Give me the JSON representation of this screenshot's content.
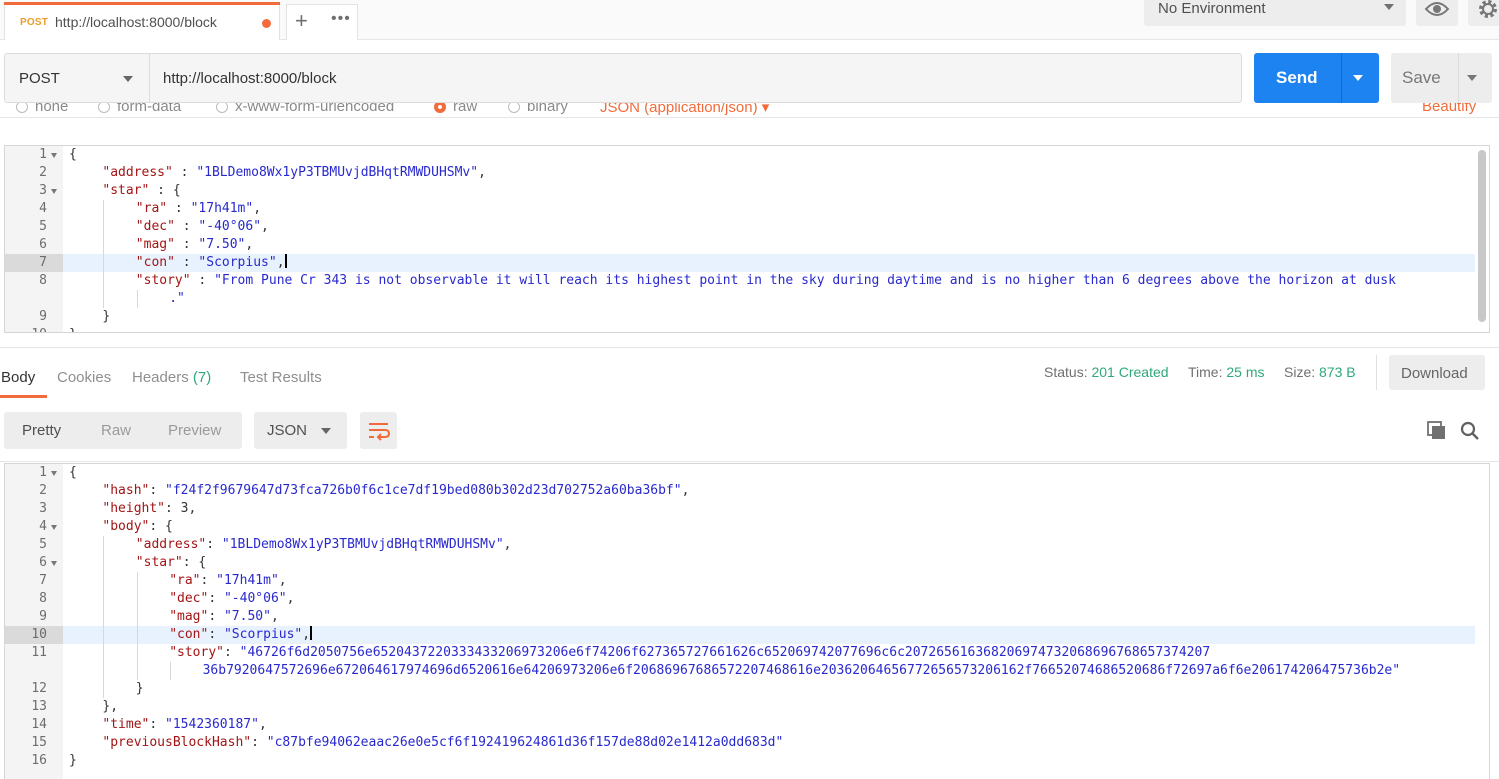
{
  "tab": {
    "method": "POST",
    "title": "http://localhost:8000/block"
  },
  "tab_actions": {
    "plus": "+",
    "more": "•••"
  },
  "environment": {
    "selected": "No Environment"
  },
  "request": {
    "method": "POST",
    "url": "http://localhost:8000/block",
    "send_label": "Send",
    "save_label": "Save"
  },
  "body_types": [
    "none",
    "form-data",
    "x-www-form-urlencoded",
    "raw",
    "binary",
    "JSON (application/json)",
    "Beautify"
  ],
  "request_body_lines": [
    {
      "n": "1",
      "fold": true,
      "indent": 0,
      "parts": [
        [
          "p",
          "{"
        ]
      ]
    },
    {
      "n": "2",
      "fold": false,
      "indent": 1,
      "parts": [
        [
          "k",
          "\"address\""
        ],
        [
          "p",
          " : "
        ],
        [
          "s",
          "\"1BLDemo8Wx1yP3TBMUvjdBHqtRMWDUHSMv\""
        ],
        [
          "p",
          ","
        ]
      ]
    },
    {
      "n": "3",
      "fold": true,
      "indent": 1,
      "parts": [
        [
          "k",
          "\"star\""
        ],
        [
          "p",
          " : {"
        ]
      ]
    },
    {
      "n": "4",
      "fold": false,
      "indent": 2,
      "parts": [
        [
          "k",
          "\"ra\""
        ],
        [
          "p",
          " : "
        ],
        [
          "s",
          "\"17h41m\""
        ],
        [
          "p",
          ","
        ]
      ]
    },
    {
      "n": "5",
      "fold": false,
      "indent": 2,
      "parts": [
        [
          "k",
          "\"dec\""
        ],
        [
          "p",
          " : "
        ],
        [
          "s",
          "\"-40°06\""
        ],
        [
          "p",
          ","
        ]
      ]
    },
    {
      "n": "6",
      "fold": false,
      "indent": 2,
      "parts": [
        [
          "k",
          "\"mag\""
        ],
        [
          "p",
          " : "
        ],
        [
          "s",
          "\"7.50\""
        ],
        [
          "p",
          ","
        ]
      ]
    },
    {
      "n": "7",
      "fold": false,
      "indent": 2,
      "active": true,
      "cursor": true,
      "parts": [
        [
          "k",
          "\"con\""
        ],
        [
          "p",
          " : "
        ],
        [
          "s",
          "\"Scorpius\""
        ],
        [
          "p",
          ","
        ]
      ]
    },
    {
      "n": "8",
      "fold": false,
      "indent": 2,
      "parts": [
        [
          "k",
          "\"story\""
        ],
        [
          "p",
          " : "
        ],
        [
          "s",
          "\"From Pune Cr 343 is not observable it will reach its highest point in the sky during daytime and is no higher than 6 degrees above the horizon at dusk"
        ]
      ]
    },
    {
      "n": "",
      "fold": false,
      "indent": 3,
      "parts": [
        [
          "s",
          ".\""
        ]
      ]
    },
    {
      "n": "9",
      "fold": false,
      "indent": 1,
      "parts": [
        [
          "p",
          "}"
        ]
      ]
    },
    {
      "n": "10",
      "fold": false,
      "indent": 0,
      "parts": [
        [
          "p",
          "}"
        ]
      ]
    }
  ],
  "response_tabs": {
    "body": "Body",
    "cookies": "Cookies",
    "headers": "Headers",
    "headers_count": "(7)",
    "tests": "Test Results"
  },
  "response_meta": {
    "status_label": "Status:",
    "status_value": "201 Created",
    "time_label": "Time:",
    "time_value": "25 ms",
    "size_label": "Size:",
    "size_value": "873 B",
    "download_label": "Download"
  },
  "response_view": {
    "pretty": "Pretty",
    "raw": "Raw",
    "preview": "Preview",
    "format": "JSON"
  },
  "response_body_lines": [
    {
      "n": "1",
      "fold": true,
      "indent": 0,
      "parts": [
        [
          "p",
          "{"
        ]
      ]
    },
    {
      "n": "2",
      "fold": false,
      "indent": 1,
      "parts": [
        [
          "k",
          "\"hash\""
        ],
        [
          "p",
          ": "
        ],
        [
          "s",
          "\"f24f2f9679647d73fca726b0f6c1ce7df19bed080b302d23d702752a60ba36bf\""
        ],
        [
          "p",
          ","
        ]
      ]
    },
    {
      "n": "3",
      "fold": false,
      "indent": 1,
      "parts": [
        [
          "k",
          "\"height\""
        ],
        [
          "p",
          ": 3,"
        ]
      ]
    },
    {
      "n": "4",
      "fold": true,
      "indent": 1,
      "parts": [
        [
          "k",
          "\"body\""
        ],
        [
          "p",
          ": {"
        ]
      ]
    },
    {
      "n": "5",
      "fold": false,
      "indent": 2,
      "parts": [
        [
          "k",
          "\"address\""
        ],
        [
          "p",
          ": "
        ],
        [
          "s",
          "\"1BLDemo8Wx1yP3TBMUvjdBHqtRMWDUHSMv\""
        ],
        [
          "p",
          ","
        ]
      ]
    },
    {
      "n": "6",
      "fold": true,
      "indent": 2,
      "parts": [
        [
          "k",
          "\"star\""
        ],
        [
          "p",
          ": {"
        ]
      ]
    },
    {
      "n": "7",
      "fold": false,
      "indent": 3,
      "parts": [
        [
          "k",
          "\"ra\""
        ],
        [
          "p",
          ": "
        ],
        [
          "s",
          "\"17h41m\""
        ],
        [
          "p",
          ","
        ]
      ]
    },
    {
      "n": "8",
      "fold": false,
      "indent": 3,
      "parts": [
        [
          "k",
          "\"dec\""
        ],
        [
          "p",
          ": "
        ],
        [
          "s",
          "\"-40°06\""
        ],
        [
          "p",
          ","
        ]
      ]
    },
    {
      "n": "9",
      "fold": false,
      "indent": 3,
      "parts": [
        [
          "k",
          "\"mag\""
        ],
        [
          "p",
          ": "
        ],
        [
          "s",
          "\"7.50\""
        ],
        [
          "p",
          ","
        ]
      ]
    },
    {
      "n": "10",
      "fold": false,
      "indent": 3,
      "active": true,
      "cursor": true,
      "parts": [
        [
          "k",
          "\"con\""
        ],
        [
          "p",
          ": "
        ],
        [
          "s",
          "\"Scorpius\""
        ],
        [
          "p",
          ","
        ]
      ]
    },
    {
      "n": "11",
      "fold": false,
      "indent": 3,
      "parts": [
        [
          "k",
          "\"story\""
        ],
        [
          "p",
          ": "
        ],
        [
          "s",
          "\"46726f6d2050756e6520437220333433206973206e6f74206f627365727661626c652069742077696c6c207265616368206974732068696768657374207"
        ]
      ]
    },
    {
      "n": "",
      "fold": false,
      "indent": 4,
      "parts": [
        [
          "s",
          "36b7920647572696e672064617974696d6520616e64206973206e6f20686967686572207468616e20362064656772656573206162f76652074686520686f72697a6f6e206174206475736b2e\""
        ]
      ]
    },
    {
      "n": "12",
      "fold": false,
      "indent": 2,
      "parts": [
        [
          "p",
          "}"
        ]
      ]
    },
    {
      "n": "13",
      "fold": false,
      "indent": 1,
      "parts": [
        [
          "p",
          "},"
        ]
      ]
    },
    {
      "n": "14",
      "fold": false,
      "indent": 1,
      "parts": [
        [
          "k",
          "\"time\""
        ],
        [
          "p",
          ": "
        ],
        [
          "s",
          "\"1542360187\""
        ],
        [
          "p",
          ","
        ]
      ]
    },
    {
      "n": "15",
      "fold": false,
      "indent": 1,
      "parts": [
        [
          "k",
          "\"previousBlockHash\""
        ],
        [
          "p",
          ": "
        ],
        [
          "s",
          "\"c87bfe94062eaac26e0e5cf6f192419624861d36f157de88d02e1412a0dd683d\""
        ]
      ]
    },
    {
      "n": "16",
      "fold": false,
      "indent": 0,
      "parts": [
        [
          "p",
          "}"
        ]
      ]
    }
  ],
  "colors": {
    "accent_orange": "#f26b3a",
    "send_blue": "#1d83f0",
    "status_green": "#2fa87a",
    "json_key": "#a31515",
    "json_string": "#2929cf"
  },
  "icons": [
    "eye-icon",
    "gear-icon",
    "plus-icon",
    "more-icon",
    "wrap-lines-icon",
    "copy-icon",
    "search-icon",
    "chevron-down-icon"
  ]
}
